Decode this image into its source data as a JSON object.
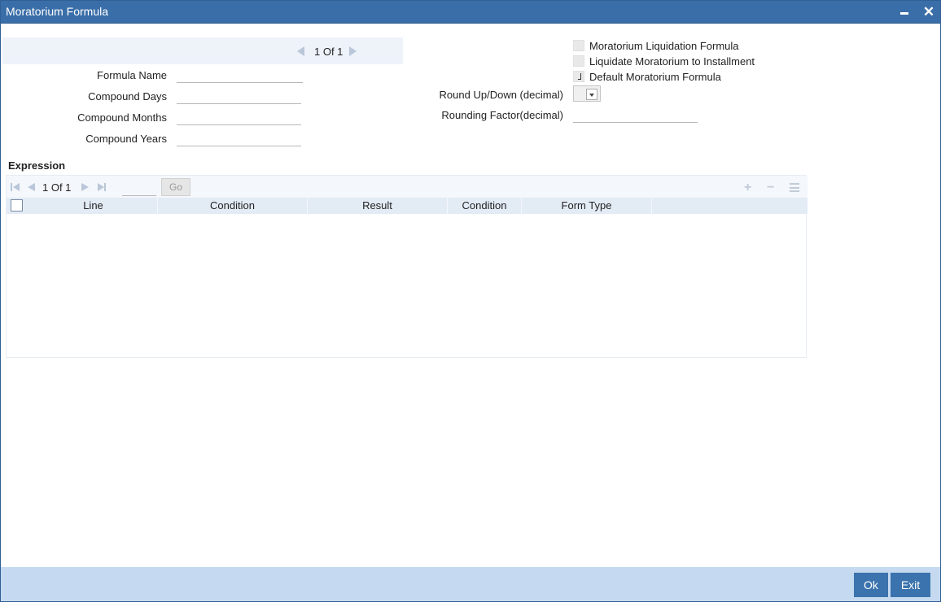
{
  "window": {
    "title": "Moratorium Formula"
  },
  "record_pager": {
    "text": "1 Of 1"
  },
  "form": {
    "formula_name_label": "Formula Name",
    "formula_name_value": "",
    "compound_days_label": "Compound Days",
    "compound_days_value": "",
    "compound_months_label": "Compound Months",
    "compound_months_value": "",
    "compound_years_label": "Compound Years",
    "compound_years_value": "",
    "round_label": "Round Up/Down (decimal)",
    "round_value": "",
    "rounding_factor_label": "Rounding Factor(decimal)",
    "rounding_factor_value": ""
  },
  "checkboxes": {
    "moratorium_liquidation": {
      "label": "Moratorium Liquidation Formula",
      "checked": false
    },
    "liquidate_to_installment": {
      "label": "Liquidate Moratorium to Installment",
      "checked": false
    },
    "default_formula": {
      "label": "Default Moratorium Formula",
      "checked": true
    }
  },
  "expression": {
    "title": "Expression",
    "page_text": "1 Of 1",
    "go_label": "Go",
    "columns": [
      "Line",
      "Condition",
      "Result",
      "Condition",
      "Form Type"
    ],
    "rows": []
  },
  "footer": {
    "ok_label": "Ok",
    "exit_label": "Exit"
  },
  "colors": {
    "titlebar": "#3a6ea8",
    "footer": "#c5daf0",
    "button": "#3a73ad"
  }
}
